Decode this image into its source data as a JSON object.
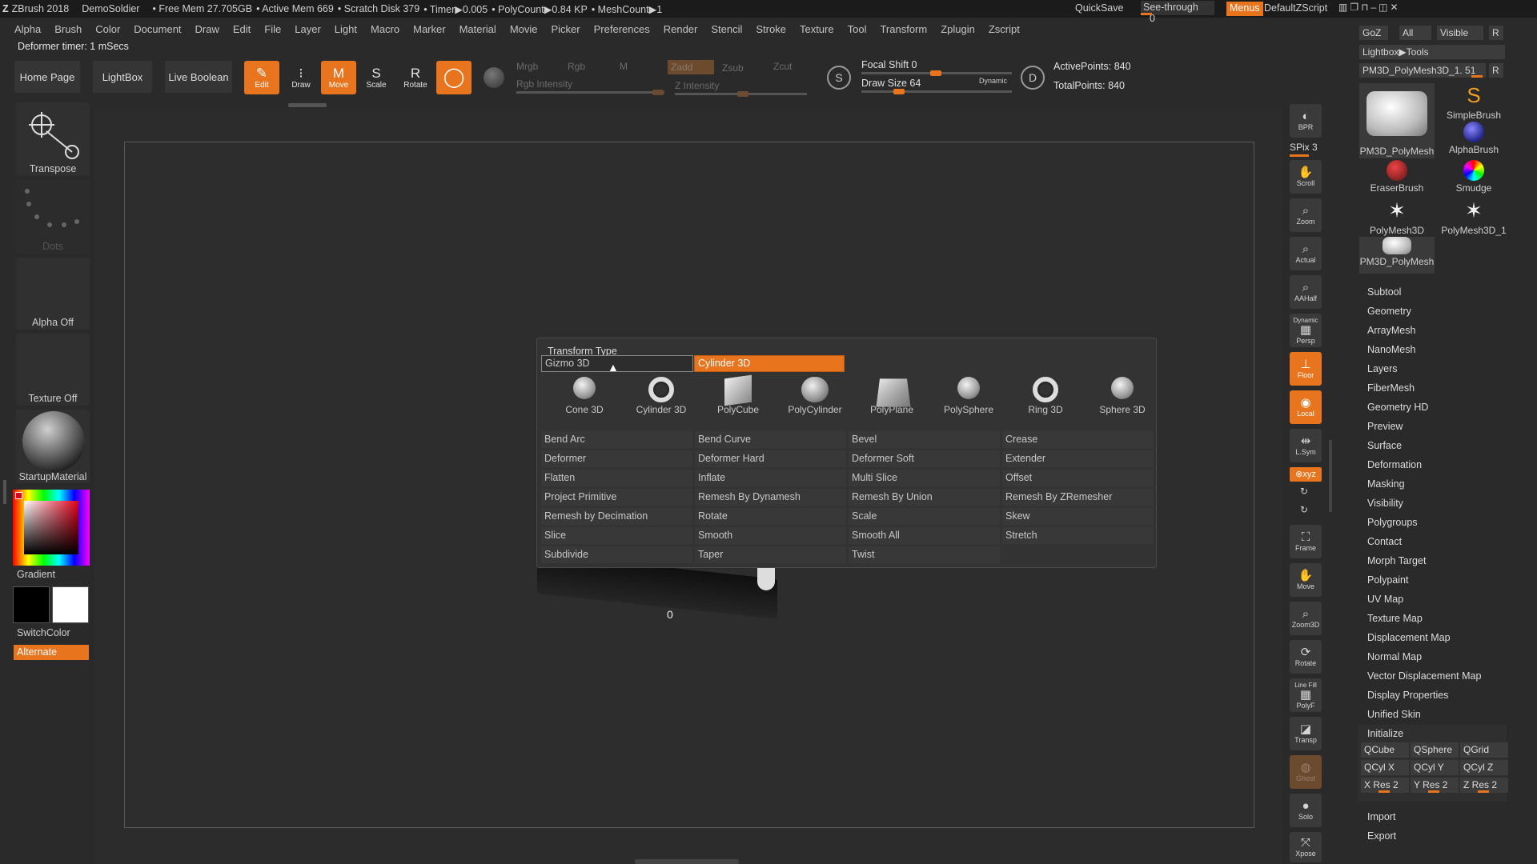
{
  "titlebar": {
    "app": "ZBrush 2018",
    "project": "DemoSoldier",
    "free_mem": "• Free Mem 27.705GB",
    "active_mem": "• Active Mem 669",
    "scratch": "• Scratch Disk 379",
    "timer": "• Timer▶0.005",
    "polycount": "• PolyCount▶0.84 KP",
    "meshcount": "• MeshCount▶1",
    "quicksave": "QuickSave",
    "seethrough": "See-through",
    "seethrough_value": "0",
    "menus": "Menus",
    "script": "DefaultZScript"
  },
  "menubar": [
    "Alpha",
    "Brush",
    "Color",
    "Document",
    "Draw",
    "Edit",
    "File",
    "Layer",
    "Light",
    "Macro",
    "Marker",
    "Material",
    "Movie",
    "Picker",
    "Preferences",
    "Render",
    "Stencil",
    "Stroke",
    "Texture",
    "Tool",
    "Transform",
    "Zplugin",
    "Zscript"
  ],
  "status": "Deformer timer: 1 mSecs",
  "toolbar": {
    "home": "Home Page",
    "lightbox": "LightBox",
    "liveboolean": "Live Boolean",
    "edit": "Edit",
    "draw": "Draw",
    "move": "Move",
    "scale": "Scale",
    "rotate": "Rotate",
    "mrgb": "Mrgb",
    "rgb": "Rgb",
    "m": "M",
    "rgb_intensity": "Rgb Intensity",
    "zadd": "Zadd",
    "zsub": "Zsub",
    "zcut": "Zcut",
    "z_intensity": "Z Intensity",
    "focal_shift": "Focal Shift 0",
    "draw_size": "Draw Size 64",
    "dynamic": "Dynamic",
    "active_points": "ActivePoints: 840",
    "total_points": "TotalPoints: 840"
  },
  "leftshelf": {
    "transpose": "Transpose",
    "dots": "Dots",
    "alpha": "Alpha Off",
    "texture": "Texture Off",
    "material": "StartupMaterial",
    "gradient": "Gradient",
    "switchcolor": "SwitchColor",
    "alternate": "Alternate"
  },
  "canvas": {
    "number_label": "0"
  },
  "popup": {
    "title": "Transform Type",
    "gizmo": "Gizmo 3D",
    "cylinder": "Cylinder 3D",
    "primitives": [
      "Cone 3D",
      "Cylinder 3D",
      "PolyCube",
      "PolyCylinder",
      "PolyPlane",
      "PolySphere",
      "Ring 3D",
      "Sphere 3D"
    ],
    "grid": [
      [
        "Bend Arc",
        "Bend Curve",
        "Bevel",
        "Crease"
      ],
      [
        "Deformer",
        "Deformer Hard",
        "Deformer Soft",
        "Extender"
      ],
      [
        "Flatten",
        "Inflate",
        "Multi Slice",
        "Offset"
      ],
      [
        "Project Primitive",
        "Remesh By Dynamesh",
        "Remesh By Union",
        "Remesh By ZRemesher"
      ],
      [
        "Remesh by Decimation",
        "Rotate",
        "Scale",
        "Skew"
      ],
      [
        "Slice",
        "Smooth",
        "Smooth All",
        "Stretch"
      ],
      [
        "Subdivide",
        "Taper",
        "Twist",
        ""
      ]
    ]
  },
  "rightstrip": {
    "bpr": "BPR",
    "spix": "SPix 3",
    "scroll": "Scroll",
    "zoom": "Zoom",
    "actual": "Actual",
    "aahalf": "AAHalf",
    "persp": "Persp",
    "dynamic": "Dynamic",
    "floor": "Floor",
    "local": "Local",
    "lsym": "L.Sym",
    "xyz": "⊗xyz",
    "frame": "Frame",
    "move": "Move",
    "zoom3d": "Zoom3D",
    "rotate": "Rotate",
    "linefill": "Line Fill",
    "polyf": "PolyF",
    "transp": "Transp",
    "ghost": "Ghost",
    "solo": "Solo",
    "xpose": "Xpose"
  },
  "rpanel": {
    "goz": "GoZ",
    "all": "All",
    "visible": "Visible",
    "r": "R",
    "lightbox_tools": "Lightbox▶Tools",
    "current_tool": "PM3D_PolyMesh3D_1. 51",
    "tools": [
      "PM3D_PolyMesh",
      "SimpleBrush",
      "AlphaBrush",
      "EraserBrush",
      "Smudge",
      "PolyMesh3D",
      "PolyMesh3D_1",
      "PM3D_PolyMesh"
    ],
    "menu": [
      "Subtool",
      "Geometry",
      "ArrayMesh",
      "NanoMesh",
      "Layers",
      "FiberMesh",
      "Geometry HD",
      "Preview",
      "Surface",
      "Deformation",
      "Masking",
      "Visibility",
      "Polygroups",
      "Contact",
      "Morph Target",
      "Polypaint",
      "UV Map",
      "Texture Map",
      "Displacement Map",
      "Normal Map",
      "Vector Displacement Map",
      "Display Properties",
      "Unified Skin"
    ],
    "initialize": "Initialize",
    "init_buttons": [
      "QCube",
      "QSphere",
      "QGrid",
      "QCyl X",
      "QCyl Y",
      "QCyl Z",
      "X Res 2",
      "Y Res 2",
      "Z Res 2"
    ],
    "import": "Import",
    "export": "Export"
  },
  "colors": {
    "accent": "#e8741e",
    "bg": "#2a2a2a",
    "panel": "#333333"
  }
}
